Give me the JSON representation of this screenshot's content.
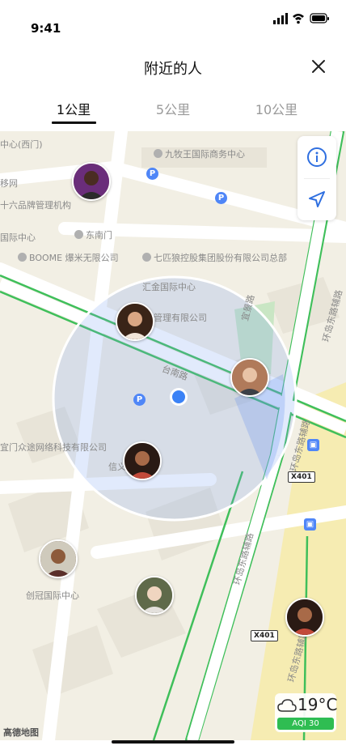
{
  "status": {
    "time": "9:41"
  },
  "nav": {
    "title": "附近的人",
    "close_icon": "close-icon"
  },
  "tabs": [
    {
      "label": "1公里",
      "active": true
    },
    {
      "label": "5公里",
      "active": false
    },
    {
      "label": "10公里",
      "active": false
    }
  ],
  "map": {
    "pois": [
      "中心(西门)",
      "九牧王国际商务中心",
      "移网",
      "十六品牌管理机构",
      "国际中心",
      "东南门",
      "BOOME 爆米无限公司",
      "七匹狼控股集团股份有限公司总部",
      "汇金国际中心",
      "管理有限公司",
      "宜门众途网络科技有限公司",
      "信义",
      "创冠国际中心"
    ],
    "roads": [
      "台南路",
      "宜景路",
      "环岛东路辅路",
      "环岛东路辅路",
      "环岛东路辅路",
      "环岛东路辅路"
    ],
    "route_badges": [
      "X401",
      "X401"
    ],
    "logo": "高德地图",
    "weather": {
      "temperature": "19°C",
      "aqi": "AQI 30",
      "icon": "cloud-icon"
    },
    "controls": {
      "info_icon": "info-icon",
      "locate_icon": "location-arrow-icon"
    },
    "radius_km": 1,
    "colors": {
      "accent": "#3b82f6",
      "aqi_green": "#2fbd52",
      "road_green": "#3fbf5a"
    }
  }
}
